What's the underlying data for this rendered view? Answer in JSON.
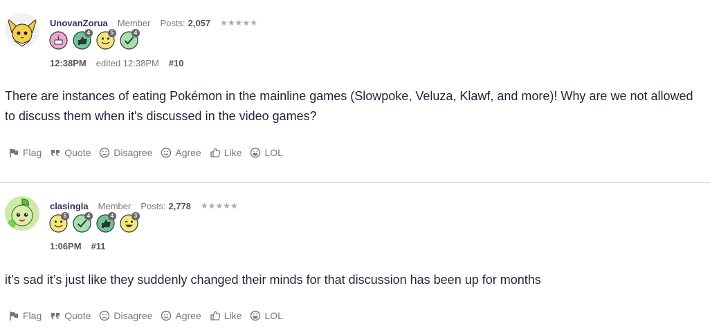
{
  "posts": [
    {
      "username": "UnovanZorua",
      "role": "Member",
      "posts_label": "Posts:",
      "posts_count": "2,057",
      "stars": "★★★★★",
      "badges": [
        {
          "icon": "cake-badge-icon",
          "count": ""
        },
        {
          "icon": "thumbs-up-badge-icon",
          "count": "4"
        },
        {
          "icon": "smiley-badge-icon",
          "count": "5"
        },
        {
          "icon": "checkmark-badge-icon",
          "count": "4"
        }
      ],
      "time": "12:38PM",
      "edited": "edited 12:38PM",
      "permalink": "#10",
      "body": "There are instances of eating Pokémon in the mainline games (Slowpoke, Veluza, Klawf, and more)! Why are we not allowed to discuss them when it's discussed in the video games?"
    },
    {
      "username": "clasingla",
      "role": "Member",
      "posts_label": "Posts:",
      "posts_count": "2,778",
      "stars": "★★★★★",
      "badges": [
        {
          "icon": "smiley-badge-icon",
          "count": "5"
        },
        {
          "icon": "checkmark-badge-icon",
          "count": "4"
        },
        {
          "icon": "thumbs-up-badge-icon",
          "count": "4"
        },
        {
          "icon": "wink-badge-icon",
          "count": "3"
        }
      ],
      "time": "1:06PM",
      "permalink": "#11",
      "body": "it’s sad it’s just like they suddenly changed their minds for that discussion has been up for months"
    }
  ],
  "actions": {
    "flag": "Flag",
    "quote": "Quote",
    "disagree": "Disagree",
    "agree": "Agree",
    "like": "Like",
    "lol": "LOL"
  },
  "colors": {
    "username": "#3d2b5e",
    "body_text": "#2a1f3a",
    "muted": "#777777",
    "divider": "#d6d6d6"
  }
}
